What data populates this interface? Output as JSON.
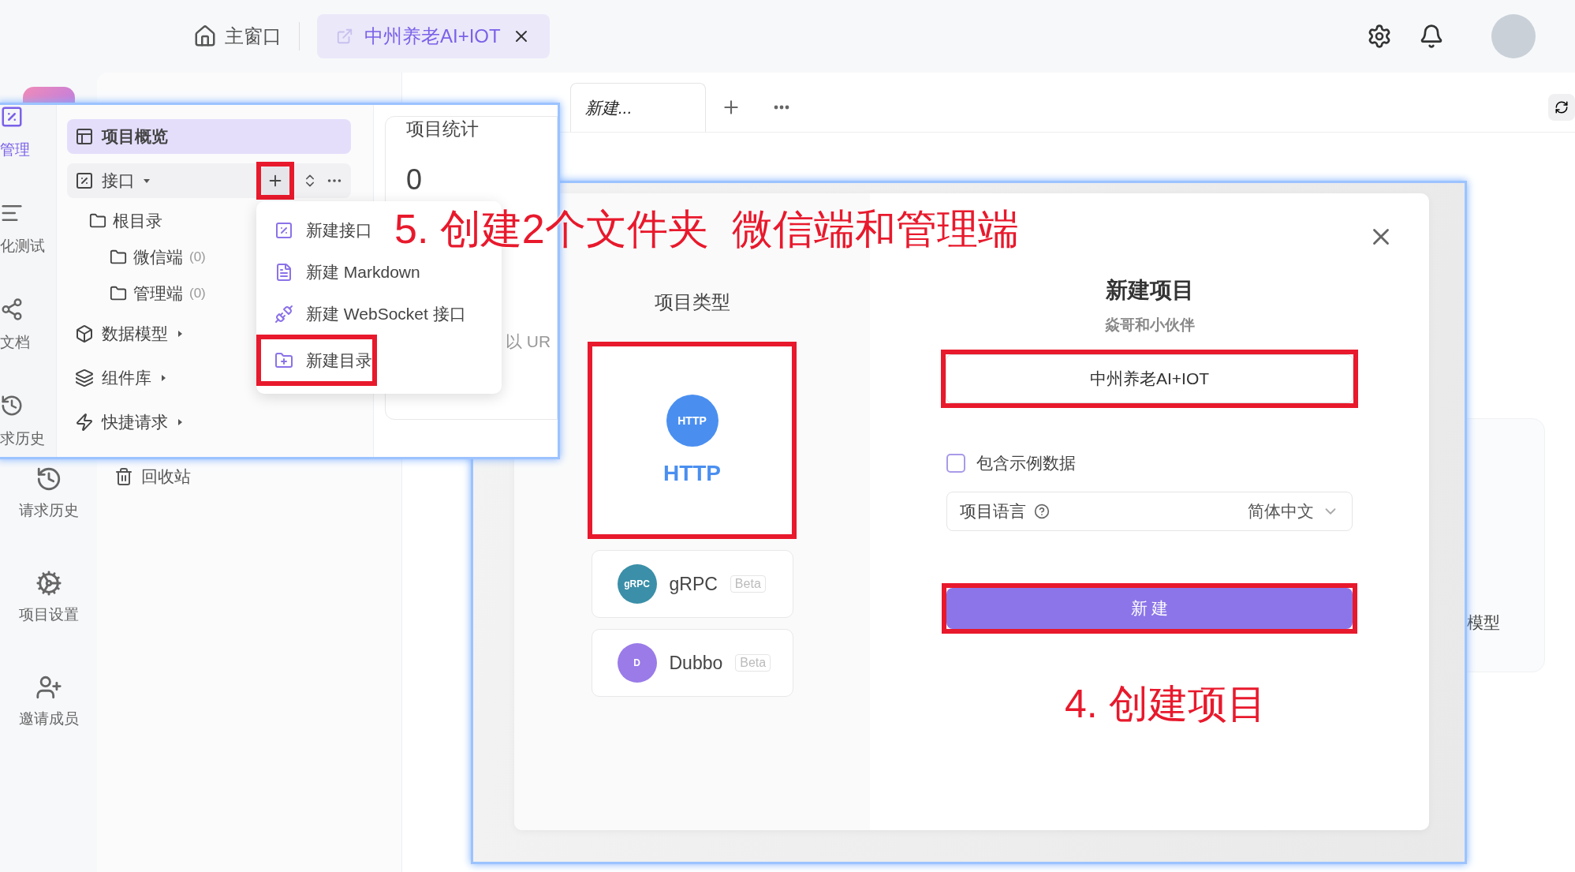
{
  "top_bar": {
    "home": "主窗口",
    "tabs": [
      {
        "label": "中州养老AI+IOT",
        "selected": true
      }
    ]
  },
  "rail": [
    {
      "kind": "history",
      "label": "请求历史",
      "selected": false
    },
    {
      "kind": "settings",
      "label": "项目设置",
      "selected": false
    },
    {
      "kind": "invite",
      "label": "邀请成员",
      "selected": false
    }
  ],
  "sidebar": [
    {
      "label": "回收站"
    }
  ],
  "tabs": [
    {
      "label": "新建...",
      "selected": true
    }
  ],
  "model_card": {
    "label": "模型"
  },
  "api_screenshot": {
    "rail": [
      {
        "kind": "api",
        "label": "管理",
        "selected": true
      },
      {
        "kind": "test",
        "label": "化测试",
        "selected": false
      },
      {
        "kind": "docs",
        "label": "文档",
        "selected": false
      },
      {
        "kind": "history",
        "label": "求历史",
        "selected": false
      }
    ],
    "tree": [
      {
        "kind": "overview",
        "label": "项目概览",
        "selected": true
      },
      {
        "kind": "api",
        "label": "接口",
        "selected": false,
        "expanded": true,
        "children": [
          {
            "label": "根目录",
            "children": [
              {
                "label": "微信端",
                "count": "(0)"
              },
              {
                "label": "管理端",
                "count": "(0)"
              }
            ]
          }
        ]
      },
      {
        "kind": "models",
        "label": "数据模型",
        "selected": false,
        "expanded": false
      },
      {
        "kind": "components",
        "label": "组件库",
        "selected": false,
        "expanded": false
      },
      {
        "kind": "quick",
        "label": "快捷请求",
        "selected": false,
        "expanded": false
      }
    ],
    "add_button": {
      "boxed": true
    },
    "menu": [
      {
        "kind": "api",
        "label": "新建接口",
        "boxed": false
      },
      {
        "kind": "markdown",
        "label": "新建 Markdown",
        "boxed": false
      },
      {
        "kind": "websocket",
        "label": "新建 WebSocket 接口",
        "boxed": false
      },
      {
        "kind": "folder",
        "label": "新建目录",
        "boxed": true
      }
    ],
    "stats": {
      "title": "项目统计",
      "value": "0",
      "note": "以 UR"
    }
  },
  "project_dialog": {
    "types_title": "项目类型",
    "types": [
      {
        "kind": "http",
        "icon_text": "HTTP",
        "label": "HTTP",
        "selected": true,
        "boxed": true
      },
      {
        "kind": "grpc",
        "icon_text": "gRPC",
        "label": "gRPC",
        "badge": "Beta",
        "selected": false,
        "boxed": false
      },
      {
        "kind": "dubbo",
        "icon_text": "D",
        "label": "Dubbo",
        "badge": "Beta",
        "selected": false,
        "boxed": false
      }
    ],
    "title": "新建项目",
    "subtitle": "焱哥和小伙伴",
    "name_field": {
      "value": "中州养老AI+IOT",
      "boxed": true
    },
    "sample_data": {
      "label": "包含示例数据",
      "checked": false
    },
    "language": {
      "label": "项目语言",
      "value": "简体中文"
    },
    "create_button": {
      "label": "新 建",
      "boxed": true
    }
  },
  "annotations": [
    {
      "text": "5. 创建2个文件夹  微信端和管理端"
    },
    {
      "text": "4. 创建项目"
    }
  ]
}
